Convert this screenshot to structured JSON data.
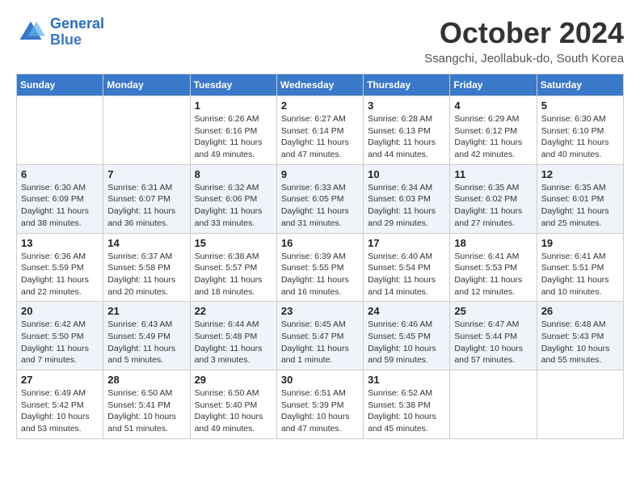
{
  "header": {
    "logo_line1": "General",
    "logo_line2": "Blue",
    "month_title": "October 2024",
    "location": "Ssangchi, Jeollabuk-do, South Korea"
  },
  "weekdays": [
    "Sunday",
    "Monday",
    "Tuesday",
    "Wednesday",
    "Thursday",
    "Friday",
    "Saturday"
  ],
  "weeks": [
    [
      null,
      null,
      {
        "day": 1,
        "sunrise": "Sunrise: 6:26 AM",
        "sunset": "Sunset: 6:16 PM",
        "daylight": "Daylight: 11 hours and 49 minutes."
      },
      {
        "day": 2,
        "sunrise": "Sunrise: 6:27 AM",
        "sunset": "Sunset: 6:14 PM",
        "daylight": "Daylight: 11 hours and 47 minutes."
      },
      {
        "day": 3,
        "sunrise": "Sunrise: 6:28 AM",
        "sunset": "Sunset: 6:13 PM",
        "daylight": "Daylight: 11 hours and 44 minutes."
      },
      {
        "day": 4,
        "sunrise": "Sunrise: 6:29 AM",
        "sunset": "Sunset: 6:12 PM",
        "daylight": "Daylight: 11 hours and 42 minutes."
      },
      {
        "day": 5,
        "sunrise": "Sunrise: 6:30 AM",
        "sunset": "Sunset: 6:10 PM",
        "daylight": "Daylight: 11 hours and 40 minutes."
      }
    ],
    [
      {
        "day": 6,
        "sunrise": "Sunrise: 6:30 AM",
        "sunset": "Sunset: 6:09 PM",
        "daylight": "Daylight: 11 hours and 38 minutes."
      },
      {
        "day": 7,
        "sunrise": "Sunrise: 6:31 AM",
        "sunset": "Sunset: 6:07 PM",
        "daylight": "Daylight: 11 hours and 36 minutes."
      },
      {
        "day": 8,
        "sunrise": "Sunrise: 6:32 AM",
        "sunset": "Sunset: 6:06 PM",
        "daylight": "Daylight: 11 hours and 33 minutes."
      },
      {
        "day": 9,
        "sunrise": "Sunrise: 6:33 AM",
        "sunset": "Sunset: 6:05 PM",
        "daylight": "Daylight: 11 hours and 31 minutes."
      },
      {
        "day": 10,
        "sunrise": "Sunrise: 6:34 AM",
        "sunset": "Sunset: 6:03 PM",
        "daylight": "Daylight: 11 hours and 29 minutes."
      },
      {
        "day": 11,
        "sunrise": "Sunrise: 6:35 AM",
        "sunset": "Sunset: 6:02 PM",
        "daylight": "Daylight: 11 hours and 27 minutes."
      },
      {
        "day": 12,
        "sunrise": "Sunrise: 6:35 AM",
        "sunset": "Sunset: 6:01 PM",
        "daylight": "Daylight: 11 hours and 25 minutes."
      }
    ],
    [
      {
        "day": 13,
        "sunrise": "Sunrise: 6:36 AM",
        "sunset": "Sunset: 5:59 PM",
        "daylight": "Daylight: 11 hours and 22 minutes."
      },
      {
        "day": 14,
        "sunrise": "Sunrise: 6:37 AM",
        "sunset": "Sunset: 5:58 PM",
        "daylight": "Daylight: 11 hours and 20 minutes."
      },
      {
        "day": 15,
        "sunrise": "Sunrise: 6:38 AM",
        "sunset": "Sunset: 5:57 PM",
        "daylight": "Daylight: 11 hours and 18 minutes."
      },
      {
        "day": 16,
        "sunrise": "Sunrise: 6:39 AM",
        "sunset": "Sunset: 5:55 PM",
        "daylight": "Daylight: 11 hours and 16 minutes."
      },
      {
        "day": 17,
        "sunrise": "Sunrise: 6:40 AM",
        "sunset": "Sunset: 5:54 PM",
        "daylight": "Daylight: 11 hours and 14 minutes."
      },
      {
        "day": 18,
        "sunrise": "Sunrise: 6:41 AM",
        "sunset": "Sunset: 5:53 PM",
        "daylight": "Daylight: 11 hours and 12 minutes."
      },
      {
        "day": 19,
        "sunrise": "Sunrise: 6:41 AM",
        "sunset": "Sunset: 5:51 PM",
        "daylight": "Daylight: 11 hours and 10 minutes."
      }
    ],
    [
      {
        "day": 20,
        "sunrise": "Sunrise: 6:42 AM",
        "sunset": "Sunset: 5:50 PM",
        "daylight": "Daylight: 11 hours and 7 minutes."
      },
      {
        "day": 21,
        "sunrise": "Sunrise: 6:43 AM",
        "sunset": "Sunset: 5:49 PM",
        "daylight": "Daylight: 11 hours and 5 minutes."
      },
      {
        "day": 22,
        "sunrise": "Sunrise: 6:44 AM",
        "sunset": "Sunset: 5:48 PM",
        "daylight": "Daylight: 11 hours and 3 minutes."
      },
      {
        "day": 23,
        "sunrise": "Sunrise: 6:45 AM",
        "sunset": "Sunset: 5:47 PM",
        "daylight": "Daylight: 11 hours and 1 minute."
      },
      {
        "day": 24,
        "sunrise": "Sunrise: 6:46 AM",
        "sunset": "Sunset: 5:45 PM",
        "daylight": "Daylight: 10 hours and 59 minutes."
      },
      {
        "day": 25,
        "sunrise": "Sunrise: 6:47 AM",
        "sunset": "Sunset: 5:44 PM",
        "daylight": "Daylight: 10 hours and 57 minutes."
      },
      {
        "day": 26,
        "sunrise": "Sunrise: 6:48 AM",
        "sunset": "Sunset: 5:43 PM",
        "daylight": "Daylight: 10 hours and 55 minutes."
      }
    ],
    [
      {
        "day": 27,
        "sunrise": "Sunrise: 6:49 AM",
        "sunset": "Sunset: 5:42 PM",
        "daylight": "Daylight: 10 hours and 53 minutes."
      },
      {
        "day": 28,
        "sunrise": "Sunrise: 6:50 AM",
        "sunset": "Sunset: 5:41 PM",
        "daylight": "Daylight: 10 hours and 51 minutes."
      },
      {
        "day": 29,
        "sunrise": "Sunrise: 6:50 AM",
        "sunset": "Sunset: 5:40 PM",
        "daylight": "Daylight: 10 hours and 49 minutes."
      },
      {
        "day": 30,
        "sunrise": "Sunrise: 6:51 AM",
        "sunset": "Sunset: 5:39 PM",
        "daylight": "Daylight: 10 hours and 47 minutes."
      },
      {
        "day": 31,
        "sunrise": "Sunrise: 6:52 AM",
        "sunset": "Sunset: 5:38 PM",
        "daylight": "Daylight: 10 hours and 45 minutes."
      },
      null,
      null
    ]
  ]
}
